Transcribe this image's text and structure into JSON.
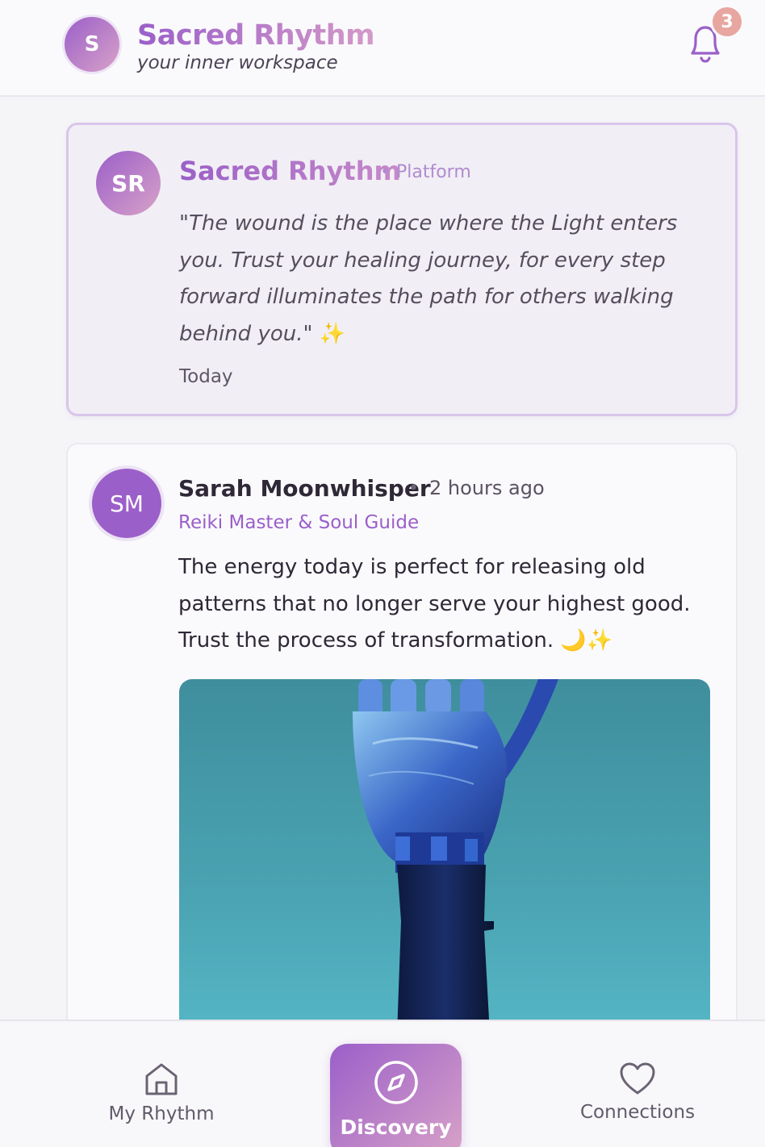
{
  "header": {
    "avatar_initial": "S",
    "title": "Sacred Rhythm",
    "subtitle": "your inner workspace",
    "notification_count": "3"
  },
  "feed": {
    "platform_post": {
      "initials": "SR",
      "author": "Sacred Rhythm",
      "role": "• Platform",
      "text": "\"The wound is the place where the Light enters you. Trust your healing journey, for every step forward illuminates the path for others walking behind you.\"",
      "emoji": "✨",
      "time": "Today"
    },
    "user_post": {
      "initials": "SM",
      "author": "Sarah Moonwhisper",
      "separator": "•",
      "time": "2 hours ago",
      "role": "Reiki Master & Soul Guide",
      "text": "The energy today is perfect for releasing old patterns that no longer serve your highest good. Trust the process of transformation.",
      "emoji": "🌙✨",
      "image_subject": "robotic-hand"
    }
  },
  "bottom_nav": {
    "items": [
      {
        "label": "My Rhythm",
        "icon": "home-icon"
      },
      {
        "label": "Discovery",
        "icon": "compass-icon",
        "active": true
      },
      {
        "label": "Connections",
        "icon": "heart-icon"
      }
    ]
  },
  "colors": {
    "accent": "#9b5fc9",
    "accent_light": "#d8a2c8",
    "badge": "#e8a6a0"
  }
}
